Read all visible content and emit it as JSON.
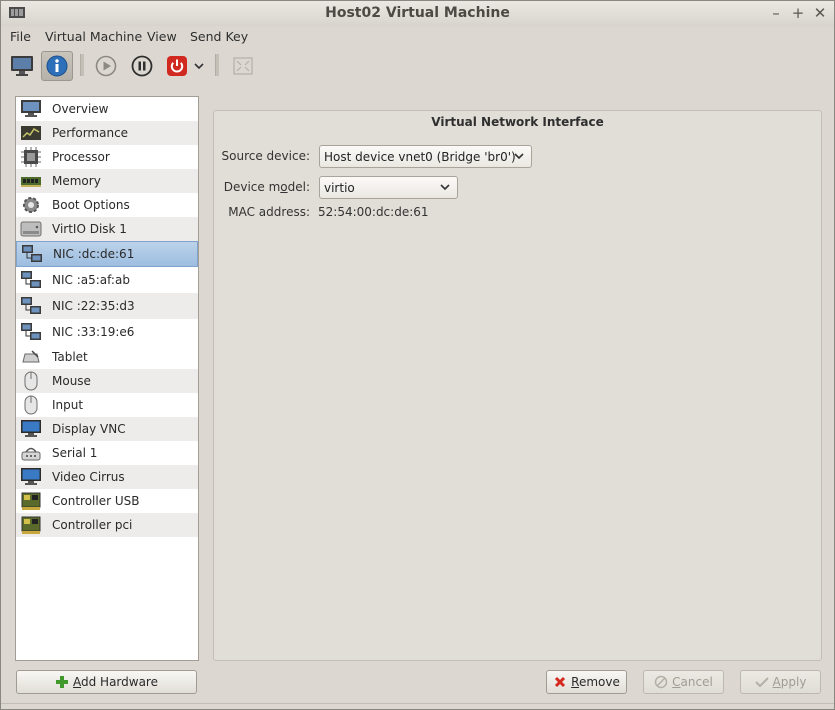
{
  "window": {
    "title": "Host02 Virtual Machine"
  },
  "menu": [
    "File",
    "Virtual Machine",
    "View",
    "Send Key"
  ],
  "toolbar": {
    "buttons": [
      {
        "name": "console",
        "icon": "monitor-icon"
      },
      {
        "name": "details",
        "icon": "info-icon",
        "active": true
      },
      {
        "name": "run",
        "icon": "play-icon"
      },
      {
        "name": "pause",
        "icon": "pause-icon"
      },
      {
        "name": "shutdown",
        "icon": "power-icon"
      },
      {
        "name": "fullscreen",
        "icon": "fullscreen-icon"
      }
    ]
  },
  "hardware_list": [
    {
      "label": "Overview",
      "icon": "monitor-icon"
    },
    {
      "label": "Performance",
      "icon": "chart-icon"
    },
    {
      "label": "Processor",
      "icon": "cpu-icon"
    },
    {
      "label": "Memory",
      "icon": "memory-icon"
    },
    {
      "label": "Boot Options",
      "icon": "gear-icon"
    },
    {
      "label": "VirtIO Disk 1",
      "icon": "disk-icon"
    },
    {
      "label": "NIC :dc:de:61",
      "icon": "network-icon",
      "selected": true
    },
    {
      "label": "NIC :a5:af:ab",
      "icon": "network-icon"
    },
    {
      "label": "NIC :22:35:d3",
      "icon": "network-icon"
    },
    {
      "label": "NIC :33:19:e6",
      "icon": "network-icon"
    },
    {
      "label": "Tablet",
      "icon": "tablet-icon"
    },
    {
      "label": "Mouse",
      "icon": "mouse-icon"
    },
    {
      "label": "Input",
      "icon": "mouse-icon"
    },
    {
      "label": "Display VNC",
      "icon": "display-icon"
    },
    {
      "label": "Serial 1",
      "icon": "serial-icon"
    },
    {
      "label": "Video Cirrus",
      "icon": "display-icon"
    },
    {
      "label": "Controller USB",
      "icon": "controller-icon"
    },
    {
      "label": "Controller pci",
      "icon": "controller-icon"
    }
  ],
  "detail": {
    "title": "Virtual Network Interface",
    "source_device_label": "Source device:",
    "source_device_value": "Host device vnet0 (Bridge 'br0')",
    "device_model_label_pre": "Device m",
    "device_model_label_u": "o",
    "device_model_label_post": "del:",
    "device_model_value": "virtio",
    "mac_label": "MAC address:",
    "mac_value": "52:54:00:dc:de:61"
  },
  "buttons": {
    "add_hardware_u": "A",
    "add_hardware_rest": "dd Hardware",
    "remove_u": "R",
    "remove_rest": "emove",
    "cancel_u": "C",
    "cancel_rest": "ancel",
    "apply_u": "A",
    "apply_rest": "pply"
  },
  "colors": {
    "selection": "#9dbde0",
    "remove": "#d42a1f",
    "add": "#3f9a2b",
    "power": "#d1281f"
  }
}
